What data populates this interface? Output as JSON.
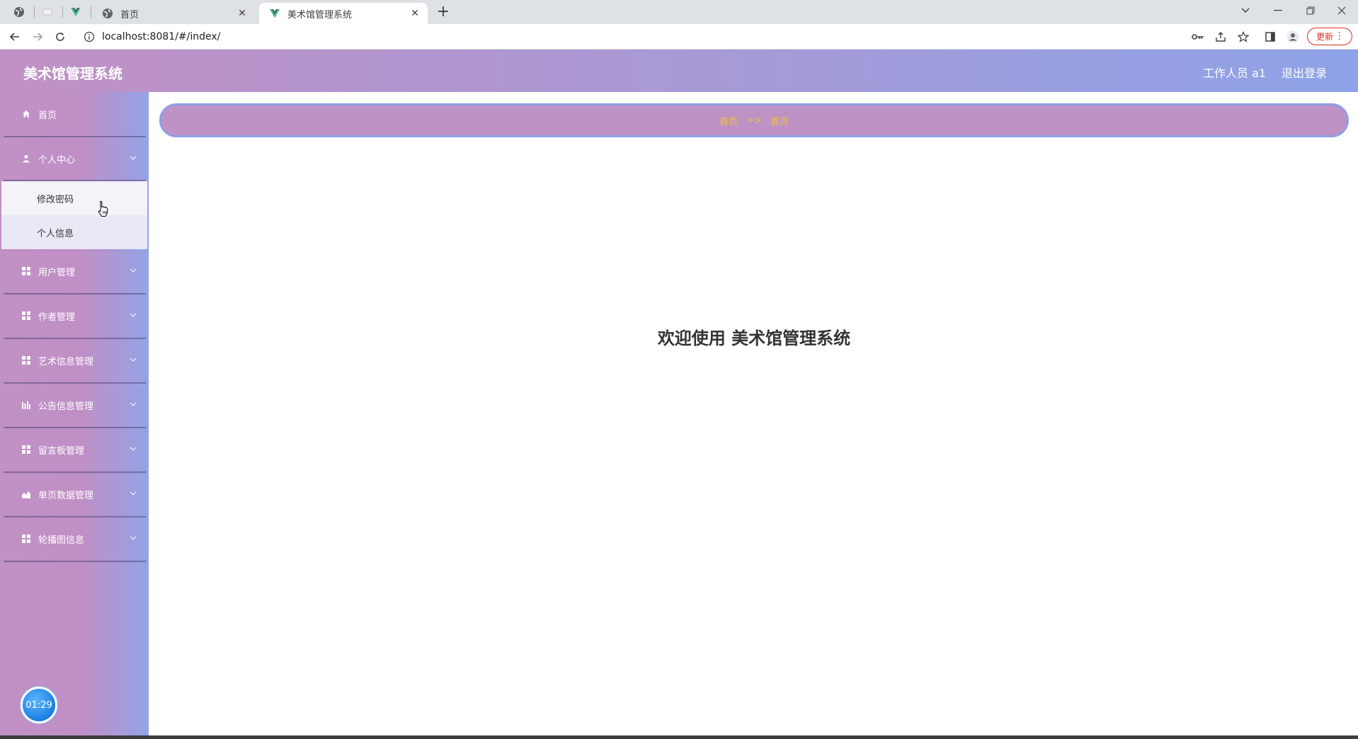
{
  "browser": {
    "tabs": [
      {
        "title": "首页",
        "active": false
      },
      {
        "title": "美术馆管理系统",
        "active": true
      }
    ],
    "url": "localhost:8081/#/index/",
    "update_label": "更新"
  },
  "header": {
    "title": "美术馆管理系统",
    "user_label": "工作人员 a1",
    "logout_label": "退出登录"
  },
  "sidebar": {
    "items": [
      {
        "label": "首页",
        "icon": "home-icon"
      },
      {
        "label": "个人中心",
        "icon": "user-icon",
        "expanded": true
      },
      {
        "label": "用户管理",
        "icon": "grid-icon"
      },
      {
        "label": "作者管理",
        "icon": "grid-icon"
      },
      {
        "label": "艺术信息管理",
        "icon": "grid-icon"
      },
      {
        "label": "公告信息管理",
        "icon": "bar-chart-icon"
      },
      {
        "label": "留言板管理",
        "icon": "grid-icon"
      },
      {
        "label": "单页数据管理",
        "icon": "area-chart-icon"
      },
      {
        "label": "轮播图信息",
        "icon": "grid-icon"
      }
    ],
    "submenu": [
      "修改密码",
      "个人信息"
    ]
  },
  "breadcrumb": {
    "home": "首页",
    "separator": ">>",
    "current": "首页"
  },
  "main": {
    "welcome": "欢迎使用 美术馆管理系统"
  },
  "timer": "01:29",
  "colors": {
    "header_start": "#c190c5",
    "header_end": "#8ea3e8",
    "breadcrumb_text": "#f1c232"
  }
}
